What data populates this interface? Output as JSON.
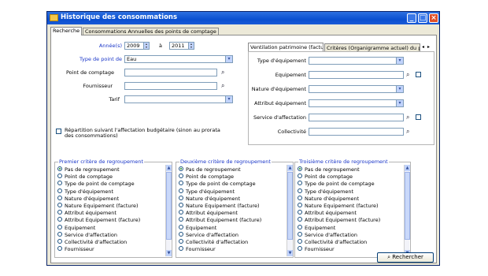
{
  "window": {
    "title": "Historique des consommations",
    "minimize": "_",
    "maximize": "□",
    "close": "×"
  },
  "tabs": [
    "Recherche",
    "Consommations Annuelles des points de comptage"
  ],
  "form": {
    "annees_label": "Année(s)",
    "year_from": "2009",
    "a_label": "à",
    "year_to": "2011",
    "type_point_label": "Type de point de",
    "type_point_value": "Eau",
    "point_comptage_label": "Point de comptage",
    "fournisseur_label": "Fournisseur",
    "tarif_label": "Tarif",
    "repartition_label": "Répartition suivant l'affectation budgétaire (sinon au prorata des consommations)"
  },
  "subtabs": [
    "Ventilation patrimoine (facture)",
    "Critères (Organigramme actuel) du patrim"
  ],
  "subtab_nav": {
    "left": "◂",
    "right": "▸"
  },
  "ventilation": {
    "type_equipement": "Type d'équipement",
    "equipement": "Equipement",
    "nature_equipement": "Nature d'équipement",
    "attribut_equipement": "Attribut équipement",
    "service_affectation": "Service d'affectation",
    "collectivite": "Collectivité"
  },
  "groups": [
    {
      "title": "Premier critère de regroupement",
      "selected": 0
    },
    {
      "title": "Deuxième critère de regroupement",
      "selected": 0
    },
    {
      "title": "Troisième critère de regroupement",
      "selected": 0
    }
  ],
  "criteria_items": [
    "Pas de regroupement",
    "Point de comptage",
    "Type de point de comptage",
    "Type d'équipement",
    "Nature d'équipement",
    "Nature Equipement (facture)",
    "Attribut équipement",
    "Attribut Equipement (facture)",
    "Equipement",
    "Service d'affectation",
    "Collectivité d'affectation",
    "Fournisseur"
  ],
  "icons": {
    "dropdown": "▾",
    "spin_up": "▴",
    "spin_down": "▾",
    "binoculars": "⌕",
    "scroll_up": "▲",
    "scroll_down": "▼"
  },
  "search_button": "Rechercher"
}
